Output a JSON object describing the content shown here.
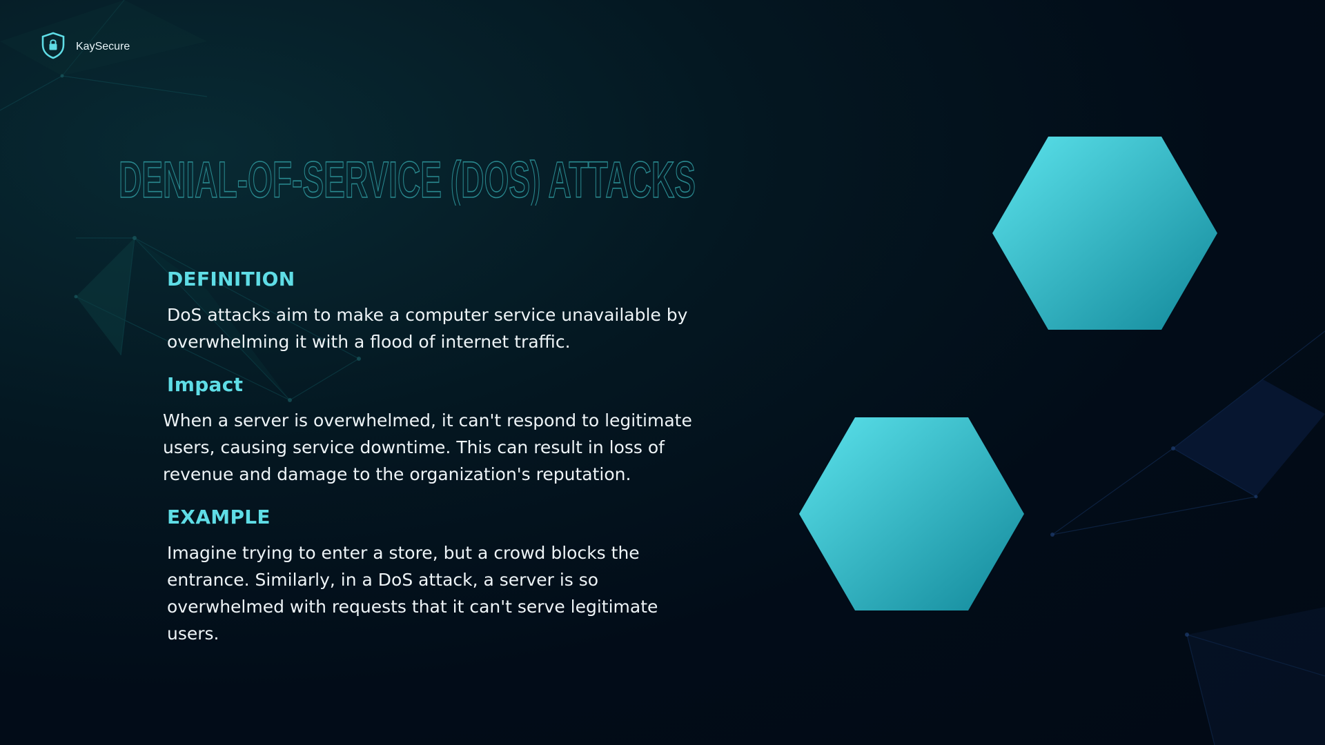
{
  "brand": {
    "name": "KaySecure",
    "icon": "shield-lock-icon"
  },
  "slide": {
    "title": "DENIAL-OF-SERVICE (DOS) ATTACKS",
    "sections": [
      {
        "heading": "DEFINITION",
        "text": "DoS attacks aim to make a computer service unavailable by overwhelming it with a flood of internet traffic."
      },
      {
        "heading": "Impact",
        "text": " When a server is overwhelmed, it can't respond to legitimate users, causing service downtime. This can result in loss of revenue and damage to the organization's reputation."
      },
      {
        "heading": "EXAMPLE",
        "text": "Imagine trying to enter a store, but a crowd blocks the entrance. Similarly, in a DoS attack, a server is so overwhelmed with requests that it can't serve legitimate users."
      }
    ]
  },
  "colors": {
    "accent": "#5fdde6",
    "title_outline": "#2a8a90",
    "hex_light": "#5ce3ec",
    "hex_dark": "#12889a",
    "background": "#020c18"
  }
}
